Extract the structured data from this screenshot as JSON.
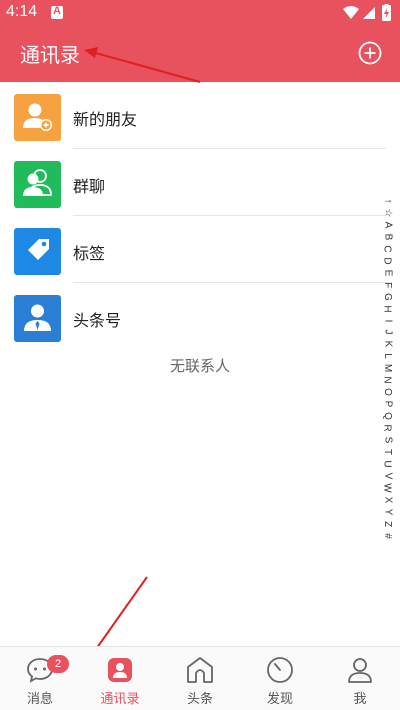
{
  "status_bar": {
    "time": "4:14"
  },
  "header": {
    "title": "通讯录"
  },
  "contacts": [
    {
      "label": "新的朋友",
      "icon": "add-friend-icon",
      "color": "#f5a340"
    },
    {
      "label": "群聊",
      "icon": "group-chat-icon",
      "color": "#20bb5a"
    },
    {
      "label": "标签",
      "icon": "tag-icon",
      "color": "#1e88e5"
    },
    {
      "label": "头条号",
      "icon": "official-account-icon",
      "color": "#2a7fd4"
    }
  ],
  "empty_text": "无联系人",
  "index_letters": [
    "↑",
    "☆",
    "A",
    "B",
    "C",
    "D",
    "E",
    "F",
    "G",
    "H",
    "I",
    "J",
    "K",
    "L",
    "M",
    "N",
    "O",
    "P",
    "Q",
    "R",
    "S",
    "T",
    "U",
    "V",
    "W",
    "X",
    "Y",
    "Z",
    "#"
  ],
  "bottom_nav": [
    {
      "label": "消息",
      "icon": "message-icon",
      "badge": "2"
    },
    {
      "label": "通讯录",
      "icon": "contacts-icon",
      "active": true
    },
    {
      "label": "头条",
      "icon": "headlines-icon"
    },
    {
      "label": "发现",
      "icon": "discover-icon"
    },
    {
      "label": "我",
      "icon": "profile-icon"
    }
  ],
  "colors": {
    "brand": "#e8515e",
    "annotation": "#e02020"
  }
}
